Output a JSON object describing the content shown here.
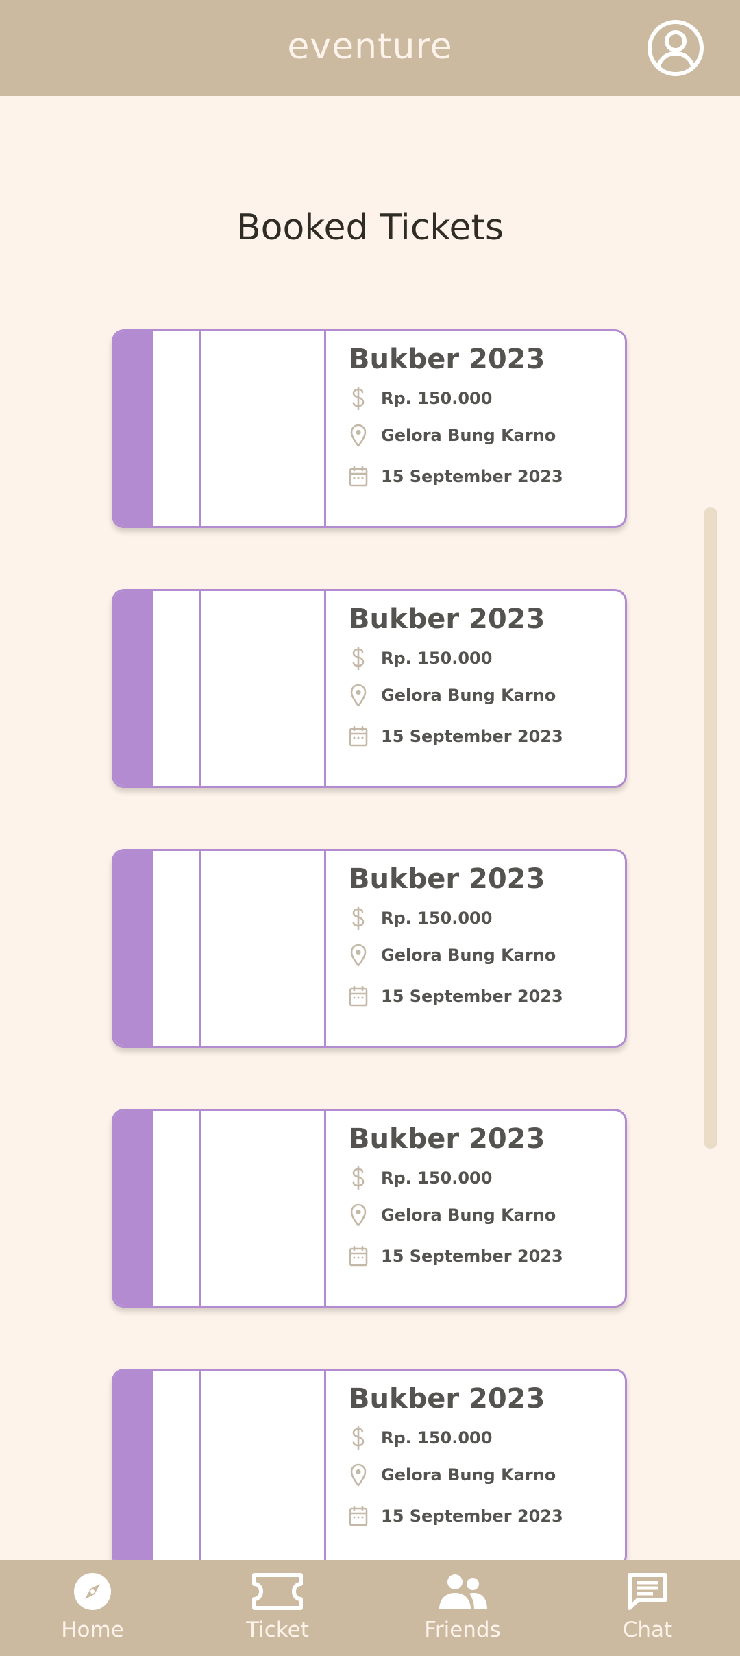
{
  "header": {
    "brand": "eventure",
    "profile_icon": "user-circle-icon"
  },
  "page": {
    "title": "Booked Tickets"
  },
  "tickets": [
    {
      "name": "Bukber 2023",
      "price": "Rp. 150.000",
      "location": "Gelora Bung Karno",
      "date": "15 September 2023"
    },
    {
      "name": "Bukber 2023",
      "price": "Rp. 150.000",
      "location": "Gelora Bung Karno",
      "date": "15 September 2023"
    },
    {
      "name": "Bukber 2023",
      "price": "Rp. 150.000",
      "location": "Gelora Bung Karno",
      "date": "15 September 2023"
    },
    {
      "name": "Bukber 2023",
      "price": "Rp. 150.000",
      "location": "Gelora Bung Karno",
      "date": "15 September 2023"
    },
    {
      "name": "Bukber 2023",
      "price": "Rp. 150.000",
      "location": "Gelora Bung Karno",
      "date": "15 September 2023"
    }
  ],
  "nav": {
    "items": [
      {
        "label": "Home",
        "icon": "compass-icon"
      },
      {
        "label": "Ticket",
        "icon": "ticket-icon"
      },
      {
        "label": "Friends",
        "icon": "people-icon"
      },
      {
        "label": "Chat",
        "icon": "chat-icon"
      }
    ]
  },
  "colors": {
    "header_bg": "#cbb9a0",
    "page_bg": "#fdf3ea",
    "accent": "#b28bd1",
    "text_dark": "#555350",
    "icon_muted": "#c4b8a8"
  }
}
